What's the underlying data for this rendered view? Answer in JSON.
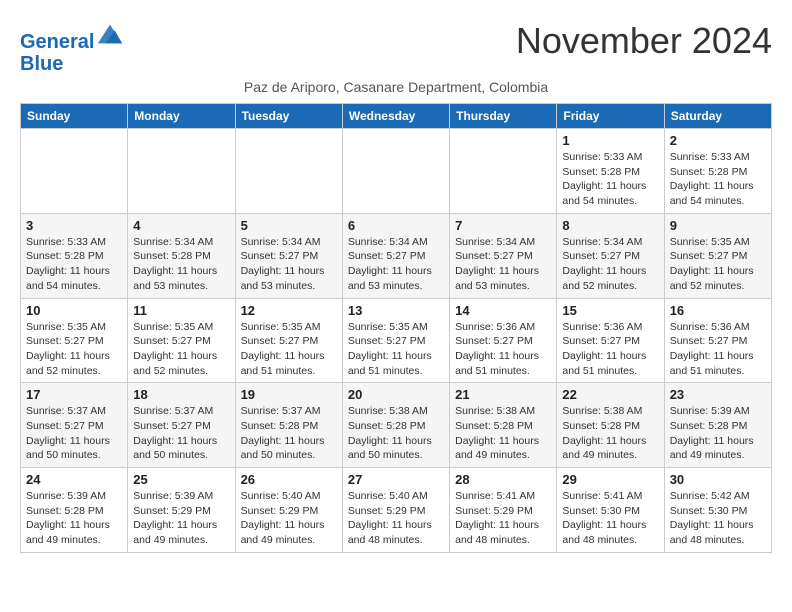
{
  "header": {
    "logo_line1": "General",
    "logo_line2": "Blue",
    "month": "November 2024",
    "subtitle": "Paz de Ariporo, Casanare Department, Colombia"
  },
  "days_of_week": [
    "Sunday",
    "Monday",
    "Tuesday",
    "Wednesday",
    "Thursday",
    "Friday",
    "Saturday"
  ],
  "weeks": [
    [
      {
        "day": "",
        "info": ""
      },
      {
        "day": "",
        "info": ""
      },
      {
        "day": "",
        "info": ""
      },
      {
        "day": "",
        "info": ""
      },
      {
        "day": "",
        "info": ""
      },
      {
        "day": "1",
        "info": "Sunrise: 5:33 AM\nSunset: 5:28 PM\nDaylight: 11 hours and 54 minutes."
      },
      {
        "day": "2",
        "info": "Sunrise: 5:33 AM\nSunset: 5:28 PM\nDaylight: 11 hours and 54 minutes."
      }
    ],
    [
      {
        "day": "3",
        "info": "Sunrise: 5:33 AM\nSunset: 5:28 PM\nDaylight: 11 hours and 54 minutes."
      },
      {
        "day": "4",
        "info": "Sunrise: 5:34 AM\nSunset: 5:28 PM\nDaylight: 11 hours and 53 minutes."
      },
      {
        "day": "5",
        "info": "Sunrise: 5:34 AM\nSunset: 5:27 PM\nDaylight: 11 hours and 53 minutes."
      },
      {
        "day": "6",
        "info": "Sunrise: 5:34 AM\nSunset: 5:27 PM\nDaylight: 11 hours and 53 minutes."
      },
      {
        "day": "7",
        "info": "Sunrise: 5:34 AM\nSunset: 5:27 PM\nDaylight: 11 hours and 53 minutes."
      },
      {
        "day": "8",
        "info": "Sunrise: 5:34 AM\nSunset: 5:27 PM\nDaylight: 11 hours and 52 minutes."
      },
      {
        "day": "9",
        "info": "Sunrise: 5:35 AM\nSunset: 5:27 PM\nDaylight: 11 hours and 52 minutes."
      }
    ],
    [
      {
        "day": "10",
        "info": "Sunrise: 5:35 AM\nSunset: 5:27 PM\nDaylight: 11 hours and 52 minutes."
      },
      {
        "day": "11",
        "info": "Sunrise: 5:35 AM\nSunset: 5:27 PM\nDaylight: 11 hours and 52 minutes."
      },
      {
        "day": "12",
        "info": "Sunrise: 5:35 AM\nSunset: 5:27 PM\nDaylight: 11 hours and 51 minutes."
      },
      {
        "day": "13",
        "info": "Sunrise: 5:35 AM\nSunset: 5:27 PM\nDaylight: 11 hours and 51 minutes."
      },
      {
        "day": "14",
        "info": "Sunrise: 5:36 AM\nSunset: 5:27 PM\nDaylight: 11 hours and 51 minutes."
      },
      {
        "day": "15",
        "info": "Sunrise: 5:36 AM\nSunset: 5:27 PM\nDaylight: 11 hours and 51 minutes."
      },
      {
        "day": "16",
        "info": "Sunrise: 5:36 AM\nSunset: 5:27 PM\nDaylight: 11 hours and 51 minutes."
      }
    ],
    [
      {
        "day": "17",
        "info": "Sunrise: 5:37 AM\nSunset: 5:27 PM\nDaylight: 11 hours and 50 minutes."
      },
      {
        "day": "18",
        "info": "Sunrise: 5:37 AM\nSunset: 5:27 PM\nDaylight: 11 hours and 50 minutes."
      },
      {
        "day": "19",
        "info": "Sunrise: 5:37 AM\nSunset: 5:28 PM\nDaylight: 11 hours and 50 minutes."
      },
      {
        "day": "20",
        "info": "Sunrise: 5:38 AM\nSunset: 5:28 PM\nDaylight: 11 hours and 50 minutes."
      },
      {
        "day": "21",
        "info": "Sunrise: 5:38 AM\nSunset: 5:28 PM\nDaylight: 11 hours and 49 minutes."
      },
      {
        "day": "22",
        "info": "Sunrise: 5:38 AM\nSunset: 5:28 PM\nDaylight: 11 hours and 49 minutes."
      },
      {
        "day": "23",
        "info": "Sunrise: 5:39 AM\nSunset: 5:28 PM\nDaylight: 11 hours and 49 minutes."
      }
    ],
    [
      {
        "day": "24",
        "info": "Sunrise: 5:39 AM\nSunset: 5:28 PM\nDaylight: 11 hours and 49 minutes."
      },
      {
        "day": "25",
        "info": "Sunrise: 5:39 AM\nSunset: 5:29 PM\nDaylight: 11 hours and 49 minutes."
      },
      {
        "day": "26",
        "info": "Sunrise: 5:40 AM\nSunset: 5:29 PM\nDaylight: 11 hours and 49 minutes."
      },
      {
        "day": "27",
        "info": "Sunrise: 5:40 AM\nSunset: 5:29 PM\nDaylight: 11 hours and 48 minutes."
      },
      {
        "day": "28",
        "info": "Sunrise: 5:41 AM\nSunset: 5:29 PM\nDaylight: 11 hours and 48 minutes."
      },
      {
        "day": "29",
        "info": "Sunrise: 5:41 AM\nSunset: 5:30 PM\nDaylight: 11 hours and 48 minutes."
      },
      {
        "day": "30",
        "info": "Sunrise: 5:42 AM\nSunset: 5:30 PM\nDaylight: 11 hours and 48 minutes."
      }
    ]
  ]
}
